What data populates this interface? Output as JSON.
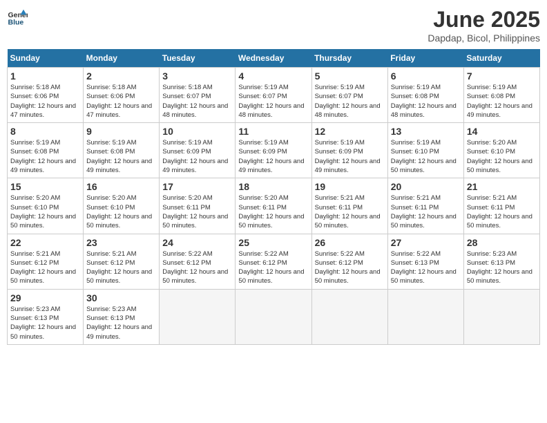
{
  "header": {
    "logo_general": "General",
    "logo_blue": "Blue",
    "title": "June 2025",
    "subtitle": "Dapdap, Bicol, Philippines"
  },
  "calendar": {
    "days_of_week": [
      "Sunday",
      "Monday",
      "Tuesday",
      "Wednesday",
      "Thursday",
      "Friday",
      "Saturday"
    ],
    "weeks": [
      [
        null,
        {
          "day": 2,
          "sunrise": "5:18 AM",
          "sunset": "6:06 PM",
          "daylight": "12 hours and 47 minutes."
        },
        {
          "day": 3,
          "sunrise": "5:18 AM",
          "sunset": "6:07 PM",
          "daylight": "12 hours and 48 minutes."
        },
        {
          "day": 4,
          "sunrise": "5:19 AM",
          "sunset": "6:07 PM",
          "daylight": "12 hours and 48 minutes."
        },
        {
          "day": 5,
          "sunrise": "5:19 AM",
          "sunset": "6:07 PM",
          "daylight": "12 hours and 48 minutes."
        },
        {
          "day": 6,
          "sunrise": "5:19 AM",
          "sunset": "6:08 PM",
          "daylight": "12 hours and 48 minutes."
        },
        {
          "day": 7,
          "sunrise": "5:19 AM",
          "sunset": "6:08 PM",
          "daylight": "12 hours and 49 minutes."
        }
      ],
      [
        {
          "day": 1,
          "sunrise": "5:18 AM",
          "sunset": "6:06 PM",
          "daylight": "12 hours and 47 minutes."
        },
        {
          "day": 9,
          "sunrise": "5:19 AM",
          "sunset": "6:08 PM",
          "daylight": "12 hours and 49 minutes."
        },
        {
          "day": 10,
          "sunrise": "5:19 AM",
          "sunset": "6:09 PM",
          "daylight": "12 hours and 49 minutes."
        },
        {
          "day": 11,
          "sunrise": "5:19 AM",
          "sunset": "6:09 PM",
          "daylight": "12 hours and 49 minutes."
        },
        {
          "day": 12,
          "sunrise": "5:19 AM",
          "sunset": "6:09 PM",
          "daylight": "12 hours and 49 minutes."
        },
        {
          "day": 13,
          "sunrise": "5:19 AM",
          "sunset": "6:10 PM",
          "daylight": "12 hours and 50 minutes."
        },
        {
          "day": 14,
          "sunrise": "5:20 AM",
          "sunset": "6:10 PM",
          "daylight": "12 hours and 50 minutes."
        }
      ],
      [
        {
          "day": 8,
          "sunrise": "5:19 AM",
          "sunset": "6:08 PM",
          "daylight": "12 hours and 49 minutes."
        },
        {
          "day": 16,
          "sunrise": "5:20 AM",
          "sunset": "6:10 PM",
          "daylight": "12 hours and 50 minutes."
        },
        {
          "day": 17,
          "sunrise": "5:20 AM",
          "sunset": "6:11 PM",
          "daylight": "12 hours and 50 minutes."
        },
        {
          "day": 18,
          "sunrise": "5:20 AM",
          "sunset": "6:11 PM",
          "daylight": "12 hours and 50 minutes."
        },
        {
          "day": 19,
          "sunrise": "5:21 AM",
          "sunset": "6:11 PM",
          "daylight": "12 hours and 50 minutes."
        },
        {
          "day": 20,
          "sunrise": "5:21 AM",
          "sunset": "6:11 PM",
          "daylight": "12 hours and 50 minutes."
        },
        {
          "day": 21,
          "sunrise": "5:21 AM",
          "sunset": "6:11 PM",
          "daylight": "12 hours and 50 minutes."
        }
      ],
      [
        {
          "day": 15,
          "sunrise": "5:20 AM",
          "sunset": "6:10 PM",
          "daylight": "12 hours and 50 minutes."
        },
        {
          "day": 23,
          "sunrise": "5:21 AM",
          "sunset": "6:12 PM",
          "daylight": "12 hours and 50 minutes."
        },
        {
          "day": 24,
          "sunrise": "5:22 AM",
          "sunset": "6:12 PM",
          "daylight": "12 hours and 50 minutes."
        },
        {
          "day": 25,
          "sunrise": "5:22 AM",
          "sunset": "6:12 PM",
          "daylight": "12 hours and 50 minutes."
        },
        {
          "day": 26,
          "sunrise": "5:22 AM",
          "sunset": "6:12 PM",
          "daylight": "12 hours and 50 minutes."
        },
        {
          "day": 27,
          "sunrise": "5:22 AM",
          "sunset": "6:13 PM",
          "daylight": "12 hours and 50 minutes."
        },
        {
          "day": 28,
          "sunrise": "5:23 AM",
          "sunset": "6:13 PM",
          "daylight": "12 hours and 50 minutes."
        }
      ],
      [
        {
          "day": 22,
          "sunrise": "5:21 AM",
          "sunset": "6:12 PM",
          "daylight": "12 hours and 50 minutes."
        },
        {
          "day": 30,
          "sunrise": "5:23 AM",
          "sunset": "6:13 PM",
          "daylight": "12 hours and 49 minutes."
        },
        null,
        null,
        null,
        null,
        null
      ],
      [
        {
          "day": 29,
          "sunrise": "5:23 AM",
          "sunset": "6:13 PM",
          "daylight": "12 hours and 50 minutes."
        },
        null,
        null,
        null,
        null,
        null,
        null
      ]
    ]
  }
}
